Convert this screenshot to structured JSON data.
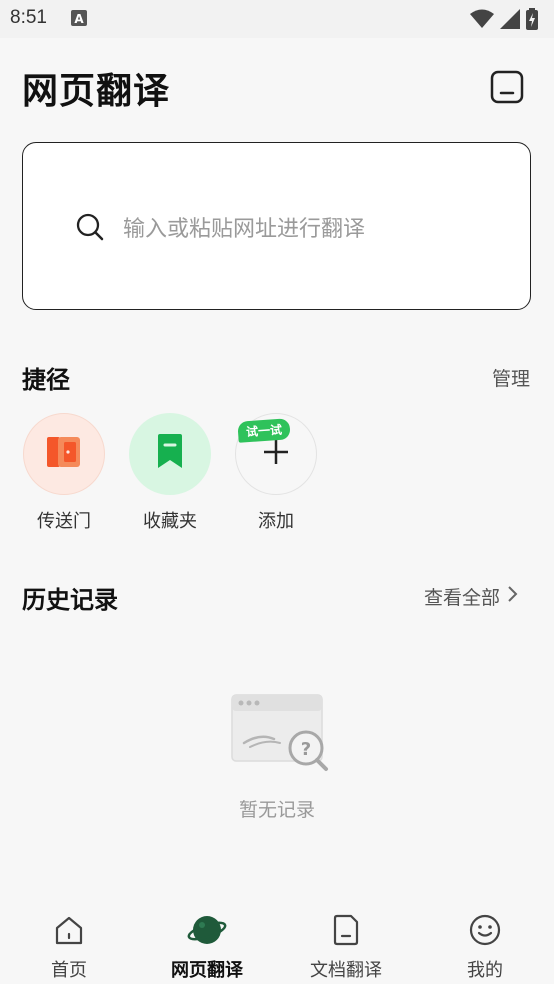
{
  "status": {
    "time": "8:51"
  },
  "header": {
    "title": "网页翻译",
    "doc_icon": "document-icon"
  },
  "search": {
    "placeholder": "输入或粘贴网址进行翻译"
  },
  "shortcuts": {
    "title": "捷径",
    "manage_label": "管理",
    "items": [
      {
        "label": "传送门",
        "icon": "portal-door-icon",
        "bg": "#fde9e2",
        "color": "#f4572a"
      },
      {
        "label": "收藏夹",
        "icon": "bookmark-icon",
        "bg": "#d8f6e2",
        "color": "#1db954"
      },
      {
        "label": "添加",
        "icon": "plus-icon",
        "bg": "#f7f7f7",
        "badge": "试一试"
      }
    ]
  },
  "history": {
    "title": "历史记录",
    "view_all_label": "查看全部",
    "empty_text": "暂无记录"
  },
  "nav": {
    "items": [
      {
        "label": "首页",
        "icon": "home-icon",
        "active": false
      },
      {
        "label": "网页翻译",
        "icon": "planet-icon",
        "active": true
      },
      {
        "label": "文档翻译",
        "icon": "document-icon",
        "active": false
      },
      {
        "label": "我的",
        "icon": "smile-face-icon",
        "active": false
      }
    ]
  },
  "colors": {
    "accent_green": "#2fc25b",
    "accent_orange": "#f4572a",
    "planet_green": "#1f5a3a"
  }
}
